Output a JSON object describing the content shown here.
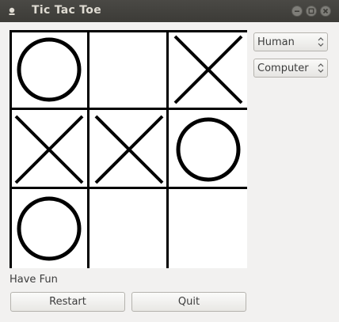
{
  "window": {
    "title": "Tic Tac Toe"
  },
  "board": {
    "cells": [
      "O",
      "",
      "X",
      "X",
      "X",
      "O",
      "O",
      "",
      ""
    ]
  },
  "controls": {
    "player1": {
      "selected": "Human"
    },
    "player2": {
      "selected": "Computer"
    }
  },
  "status": "Have Fun",
  "buttons": {
    "restart": "Restart",
    "quit": "Quit"
  }
}
